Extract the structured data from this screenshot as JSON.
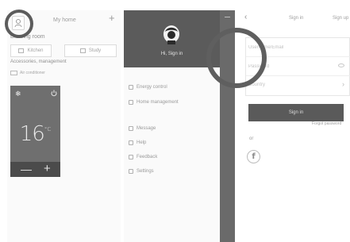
{
  "panel1": {
    "home_title": "My home",
    "add_symbol": "+",
    "room_label": "Drawing room",
    "rooms": [
      "Kitchen",
      "Study"
    ],
    "section_label": "Accessories, management",
    "device_tag": "Air conditioner",
    "card": {
      "temperature": "16",
      "unit": "°C",
      "minus": "—",
      "plus": "+",
      "icons": [
        "snowflake-icon",
        "power-icon"
      ]
    }
  },
  "panel2": {
    "username": "Hi, Sign in",
    "menu_group1": [
      "Energy control",
      "Home management"
    ],
    "menu_group2": [
      "Message",
      "Help",
      "Feedback",
      "Settings"
    ]
  },
  "panel3": {
    "back_symbol": "‹",
    "tab_signin": "Sign in",
    "tab_signup": "Sign up",
    "username_placeholder": "Username/Email",
    "password_placeholder": "Password",
    "country_label": "Country",
    "chevron": "›",
    "signin_button": "Sign in",
    "forgot_password": "Forgot password",
    "or_label": "or",
    "facebook_symbol": "f"
  },
  "colors": {
    "dark_panel": "#5b5b5b",
    "card": "#6f6f6f",
    "button": "#5a5a5a",
    "highlight_circle": "#5c5c5c"
  }
}
